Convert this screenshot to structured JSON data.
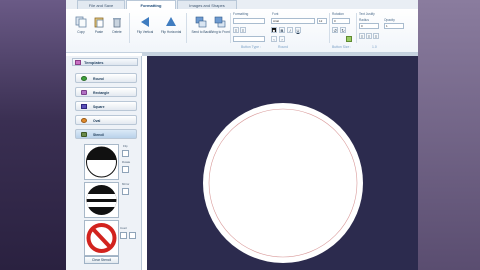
{
  "tabs": [
    {
      "label": "File and Save"
    },
    {
      "label": "Formatting"
    },
    {
      "label": "Images and Shapes"
    }
  ],
  "ribbon": {
    "buttons": [
      {
        "label": "Copy"
      },
      {
        "label": "Paste"
      },
      {
        "label": "Delete"
      },
      {
        "label": "Flip Vertical"
      },
      {
        "label": "Flip Horizontal"
      },
      {
        "label": "Send to Back"
      },
      {
        "label": "Bring to Front"
      }
    ],
    "groups": {
      "formatting": "Formatting",
      "font": "Font",
      "rotation": "Rotation",
      "text_justify": "Text Justify"
    },
    "font_name": "Arial",
    "font_size": "12",
    "rotation_value": "0",
    "radius_value": "0",
    "radius_label": "Radius",
    "opacity_label": "Opacity",
    "opacity_value": "1",
    "button_type_label": "Button Type :",
    "button_type_value": "Round",
    "button_size_label": "Button Size :",
    "button_size_value": "1.0"
  },
  "left_panel": {
    "title": "Templates",
    "items": [
      {
        "label": "Round",
        "color": "#3fa23c"
      },
      {
        "label": "Rectangle",
        "color": "#b06fc3"
      },
      {
        "label": "Square",
        "color": "#5a4fb8"
      },
      {
        "label": "Oval",
        "color": "#e08b2c"
      },
      {
        "label": "Stencil",
        "color": "#6a8a4a"
      }
    ],
    "checkbox_labels": [
      "Flip",
      "Rotate",
      "Mirror",
      "Invert"
    ],
    "clear_button": "Clear Stencil"
  },
  "colors": {
    "canvas_bg": "#2c2b4e",
    "accent": "#3d6fa8"
  }
}
